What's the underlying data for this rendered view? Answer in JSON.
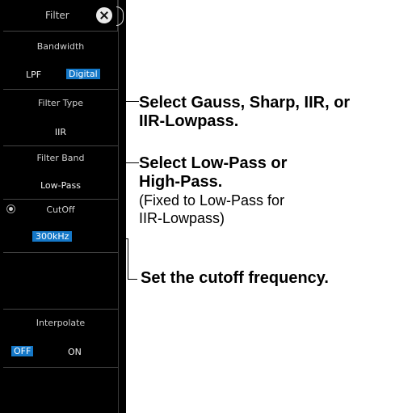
{
  "panel": {
    "title": "Filter",
    "bandwidth": {
      "label": "Bandwidth",
      "lpf": "LPF",
      "digital": "Digital"
    },
    "filter_type": {
      "label": "Filter Type",
      "value": "IIR"
    },
    "filter_band": {
      "label": "Filter Band",
      "value": "Low-Pass"
    },
    "cutoff": {
      "label": "CutOff",
      "value_num": "300",
      "value_unit": "kHz"
    },
    "interpolate": {
      "label": "Interpolate",
      "off": "OFF",
      "on": "ON"
    }
  },
  "callouts": {
    "filter_type": [
      "Select Gauss, Sharp, IIR, or",
      "IIR-Lowpass."
    ],
    "filter_band_bold": [
      "Select Low-Pass or",
      "High-Pass."
    ],
    "filter_band_note": [
      "(Fixed to Low-Pass for",
      "IIR-Lowpass)"
    ],
    "cutoff": "Set the cutoff frequency."
  },
  "colors": {
    "panel_bg": "#000000",
    "highlight": "#1578c8",
    "text": "#cfcfcf"
  },
  "icons": {
    "close": "close-icon",
    "radio": "radio-icon"
  }
}
